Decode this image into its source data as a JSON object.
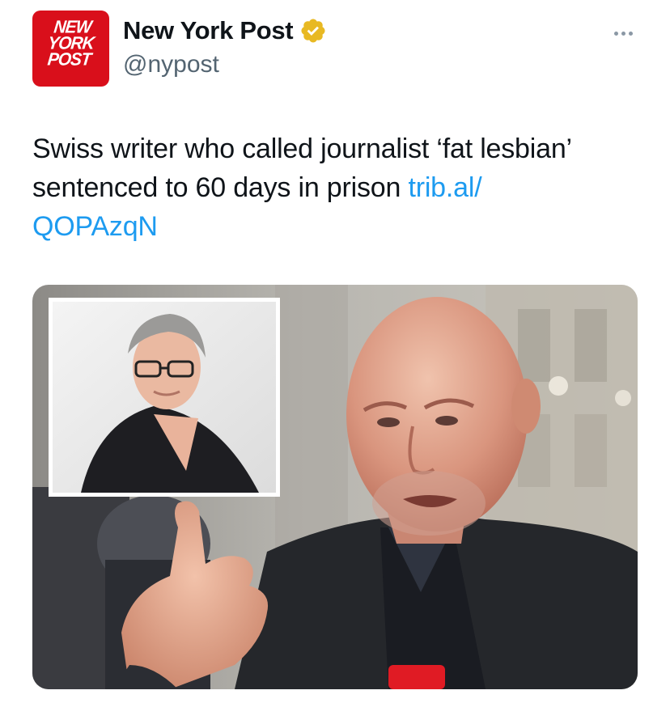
{
  "account": {
    "display_name": "New York Post",
    "handle": "@nypost",
    "verified_badge_icon": "verified-gold-check-icon",
    "badge_color": "#e8b923",
    "brand_color": "#d90f1b",
    "avatar_logo_text": "NEW\nYORK\nPOST"
  },
  "more_menu": {
    "icon": "more-horizontal-icon"
  },
  "tweet": {
    "text": "Swiss writer who called journalist ‘fat lesbian’ sentenced to 60 days in prison ",
    "link_text": "trib.al/\nQOPAzqN",
    "link_color": "#1d9bf0"
  },
  "media": {
    "alt_description": "Photo: bald man pointing finger upward with inset photo of woman wearing glasses"
  }
}
